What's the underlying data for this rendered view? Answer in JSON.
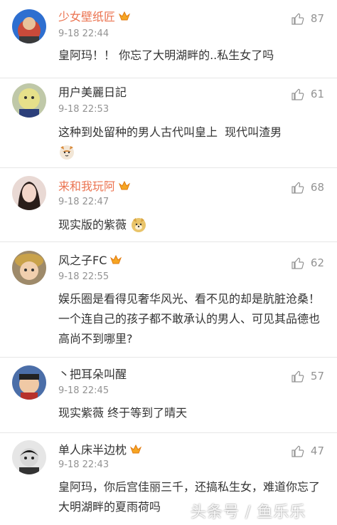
{
  "comments": [
    {
      "name": "少女壁纸匠",
      "vip": true,
      "time": "9-18 22:44",
      "likes": "87",
      "text": "皇阿玛！！ 你忘了大明湖畔的..私生女了吗"
    },
    {
      "name": "用户美麗日記",
      "vip": false,
      "time": "9-18 22:53",
      "likes": "61",
      "text": "这种到处留种的男人古代叫皇上  现代叫渣男"
    },
    {
      "name": "来和我玩阿",
      "vip": true,
      "time": "9-18 22:47",
      "likes": "68",
      "text": "现实版的紫薇"
    },
    {
      "name": "风之子FC",
      "vip": true,
      "time": "9-18 22:55",
      "likes": "62",
      "text": "娱乐圈是看得见奢华风光、看不见的却是肮脏沧桑！一个连自己的孩子都不敢承认的男人、可见其品德也高尚不到哪里?"
    },
    {
      "name": "丶把耳朵叫醒",
      "vip": false,
      "time": "9-18 22:45",
      "likes": "57",
      "text": "现实紫薇 终于等到了晴天"
    },
    {
      "name": "单人床半边枕",
      "vip": true,
      "time": "9-18 22:43",
      "likes": "47",
      "text": "皇阿玛，你后宫佳丽三千，还搞私生女，难道你忘了大明湖畔的夏雨荷吗"
    }
  ],
  "watermark": "头条号 / 鱼乐乐",
  "colors": {
    "vip_name": "#eb7350",
    "normal_name": "#333333",
    "meta": "#939393",
    "divider": "#e6e6e6"
  }
}
